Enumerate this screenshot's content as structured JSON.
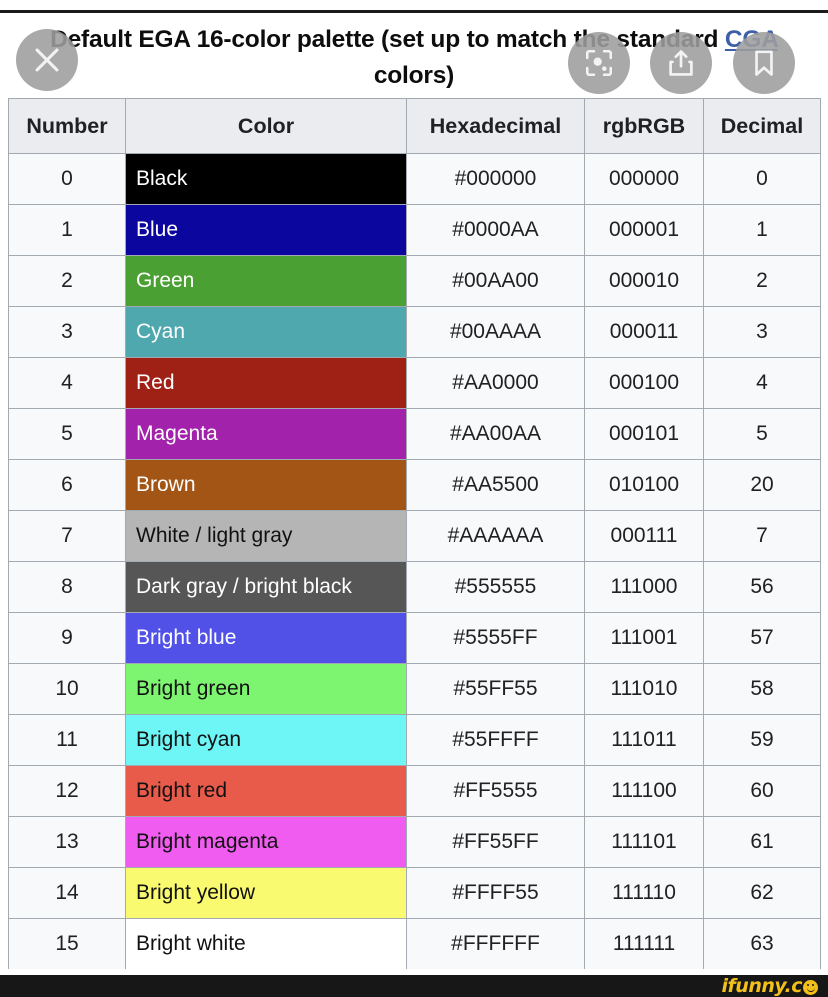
{
  "title": {
    "text_before": "Default EGA 16-color palette (set up to match the standard ",
    "link_text": "CGA",
    "text_after": " colors)",
    "full": "Default EGA 16-color palette (set up to match the standard CGA colors)",
    "link_color": "#3e5fa8"
  },
  "overlay_buttons": [
    {
      "name": "close-icon",
      "label": "Close"
    },
    {
      "name": "lens-icon",
      "label": "Google Lens"
    },
    {
      "name": "share-icon",
      "label": "Share"
    },
    {
      "name": "bookmark-icon",
      "label": "Save"
    }
  ],
  "table": {
    "headers": [
      "Number",
      "Color",
      "Hexadecimal",
      "rgbRGB",
      "Decimal"
    ],
    "rows": [
      {
        "number": "0",
        "color": "Black",
        "hex": "#000000",
        "rgb": "000000",
        "decimal": "0",
        "swatch": "#000000",
        "text_color": "#ffffff"
      },
      {
        "number": "1",
        "color": "Blue",
        "hex": "#0000AA",
        "rgb": "000001",
        "decimal": "1",
        "swatch": "#0b069e",
        "text_color": "#ffffff"
      },
      {
        "number": "2",
        "color": "Green",
        "hex": "#00AA00",
        "rgb": "000010",
        "decimal": "2",
        "swatch": "#4aa032",
        "text_color": "#ffffff"
      },
      {
        "number": "3",
        "color": "Cyan",
        "hex": "#00AAAA",
        "rgb": "000011",
        "decimal": "3",
        "swatch": "#4fa8ae",
        "text_color": "#ffffff"
      },
      {
        "number": "4",
        "color": "Red",
        "hex": "#AA0000",
        "rgb": "000100",
        "decimal": "4",
        "swatch": "#9f2014",
        "text_color": "#ffffff"
      },
      {
        "number": "5",
        "color": "Magenta",
        "hex": "#AA00AA",
        "rgb": "000101",
        "decimal": "5",
        "swatch": "#a322ab",
        "text_color": "#ffffff"
      },
      {
        "number": "6",
        "color": "Brown",
        "hex": "#AA5500",
        "rgb": "010100",
        "decimal": "20",
        "swatch": "#a35516",
        "text_color": "#ffffff"
      },
      {
        "number": "7",
        "color": "White / light gray",
        "hex": "#AAAAAA",
        "rgb": "000111",
        "decimal": "7",
        "swatch": "#b5b5b5",
        "text_color": "#111111"
      },
      {
        "number": "8",
        "color": "Dark gray / bright black",
        "hex": "#555555",
        "rgb": "111000",
        "decimal": "56",
        "swatch": "#565656",
        "text_color": "#ffffff"
      },
      {
        "number": "9",
        "color": "Bright blue",
        "hex": "#5555FF",
        "rgb": "111001",
        "decimal": "57",
        "swatch": "#5151e8",
        "text_color": "#ffffff"
      },
      {
        "number": "10",
        "color": "Bright green",
        "hex": "#55FF55",
        "rgb": "111010",
        "decimal": "58",
        "swatch": "#7ef571",
        "text_color": "#111111"
      },
      {
        "number": "11",
        "color": "Bright cyan",
        "hex": "#55FFFF",
        "rgb": "111011",
        "decimal": "59",
        "swatch": "#6ef5f5",
        "text_color": "#111111"
      },
      {
        "number": "12",
        "color": "Bright red",
        "hex": "#FF5555",
        "rgb": "111100",
        "decimal": "60",
        "swatch": "#e85a4a",
        "text_color": "#111111"
      },
      {
        "number": "13",
        "color": "Bright magenta",
        "hex": "#FF55FF",
        "rgb": "111101",
        "decimal": "61",
        "swatch": "#ef5cef",
        "text_color": "#111111"
      },
      {
        "number": "14",
        "color": "Bright yellow",
        "hex": "#FFFF55",
        "rgb": "111110",
        "decimal": "62",
        "swatch": "#fafa70",
        "text_color": "#111111"
      },
      {
        "number": "15",
        "color": "Bright white",
        "hex": "#FFFFFF",
        "rgb": "111111",
        "decimal": "63",
        "swatch": "#ffffff",
        "text_color": "#111111"
      }
    ]
  },
  "watermark": {
    "text": "ifunny.c",
    "color": "#f3c01b"
  }
}
